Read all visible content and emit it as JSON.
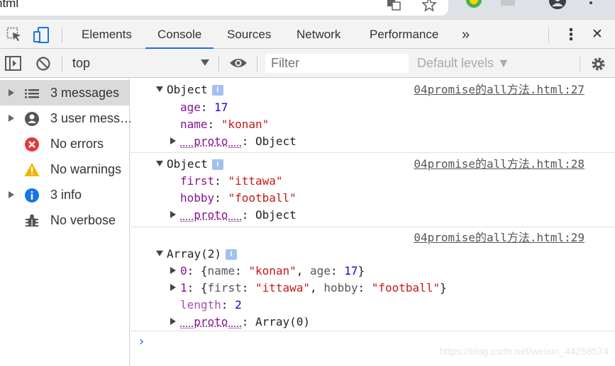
{
  "browser": {
    "title_fragment": "ntml",
    "icons": [
      "translate-icon",
      "star-icon",
      "extension-icon",
      "profile-icon",
      "menu-icon"
    ]
  },
  "devtools": {
    "tabs": [
      "Elements",
      "Console",
      "Sources",
      "Network",
      "Performance"
    ],
    "active_tab": "Console",
    "more_tabs": "»",
    "kebab": "⋮",
    "close": "✕"
  },
  "console_toolbar": {
    "context": "top",
    "filter_placeholder": "Filter",
    "levels_label": "Default levels ▼"
  },
  "sidebar": {
    "items": [
      {
        "label": "3 messages",
        "icon": "list-icon",
        "expandable": true,
        "selected": true
      },
      {
        "label": "3 user mess…",
        "icon": "user-icon",
        "expandable": true,
        "selected": false
      },
      {
        "label": "No errors",
        "icon": "error-icon",
        "expandable": false,
        "selected": false
      },
      {
        "label": "No warnings",
        "icon": "warning-icon",
        "expandable": false,
        "selected": false
      },
      {
        "label": "3 info",
        "icon": "info-icon",
        "expandable": true,
        "selected": false
      },
      {
        "label": "No verbose",
        "icon": "bug-icon",
        "expandable": false,
        "selected": false
      }
    ]
  },
  "messages": [
    {
      "source": "04promise的all方法.html:27",
      "header": "Object",
      "props": [
        {
          "key": "age",
          "value": "17",
          "type": "number"
        },
        {
          "key": "name",
          "value": "\"konan\"",
          "type": "string"
        }
      ],
      "proto": {
        "key": "__proto__",
        "value": "Object"
      }
    },
    {
      "source": "04promise的all方法.html:28",
      "header": "Object",
      "props": [
        {
          "key": "first",
          "value": "\"ittawa\"",
          "type": "string"
        },
        {
          "key": "hobby",
          "value": "\"football\"",
          "type": "string"
        }
      ],
      "proto": {
        "key": "__proto__",
        "value": "Object"
      }
    },
    {
      "source": "04promise的all方法.html:29",
      "header": "Array(2)",
      "items": [
        {
          "index": "0",
          "key1": "name",
          "val1": "\"konan\"",
          "key2": "age",
          "val2": "17"
        },
        {
          "index": "1",
          "key1": "first",
          "val1": "\"ittawa\"",
          "key2": "hobby",
          "val2": "\"football\""
        }
      ],
      "length_key": "length",
      "length_value": "2",
      "proto": {
        "key": "__proto__",
        "value": "Array(0)"
      }
    }
  ],
  "watermark": "https://blog.csdn.net/weixin_44258574",
  "colors": {
    "accent": "#1a73e8",
    "key": "#881391",
    "string": "#c41a16",
    "number": "#1c00cf",
    "error": "#e53935",
    "warning": "#f4b400",
    "info": "#1a73e8"
  }
}
